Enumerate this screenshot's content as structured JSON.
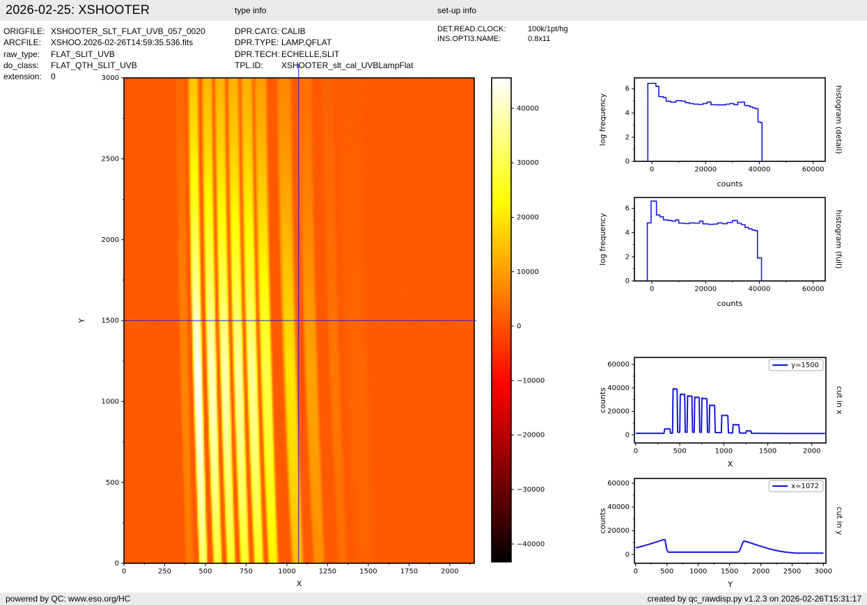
{
  "header": {
    "title": "2026-02-25: XSHOOTER",
    "type_info_label": "type info",
    "setup_info_label": "set-up info"
  },
  "metadata": {
    "file_info": [
      {
        "label": "ORIGFILE:",
        "value": "XSHOOTER_SLT_FLAT_UVB_057_0020"
      },
      {
        "label": "ARCFILE:",
        "value": "XSHOO.2026-02-26T14:59:35.536.fits"
      },
      {
        "label": "raw_type:",
        "value": "FLAT_SLIT_UVB"
      },
      {
        "label": "do_class:",
        "value": "FLAT_QTH_SLIT_UVB"
      },
      {
        "label": "extension:",
        "value": "0"
      }
    ],
    "type_info": [
      {
        "label": "DPR.CATG:",
        "value": "CALIB"
      },
      {
        "label": "DPR.TYPE:",
        "value": "LAMP,QFLAT"
      },
      {
        "label": "DPR.TECH:",
        "value": "ECHELLE,SLIT"
      },
      {
        "label": "TPL.ID:",
        "value": "XSHOOTER_slt_cal_UVBLampFlat"
      }
    ],
    "setup_info": [
      {
        "label": "DET.READ.CLOCK:",
        "value": "100k/1pt/hg"
      },
      {
        "label": "INS.OPTI3.NAME:",
        "value": "0.8x11"
      }
    ]
  },
  "footer": {
    "left": "powered by QC: www.eso.org/HC",
    "right": "created by qc_rawdisp.py v1.2.3 on 2026-02-26T15:31:17"
  },
  "colors": {
    "header_bg": "#ebebeb",
    "footer_bg": "#ebebeb",
    "plot_line": "#1616dd",
    "crosshair": "#2222e8",
    "frame": "#000000",
    "image_background_orange": "#ff5a00",
    "text": "#000000"
  },
  "chart_data": [
    {
      "id": "main-image",
      "type": "heatmap",
      "xlabel": "X",
      "ylabel": "Y",
      "xlim": [
        0,
        2150
      ],
      "ylim": [
        0,
        3000
      ],
      "xticks": [
        0,
        250,
        500,
        750,
        1000,
        1250,
        1500,
        1750,
        2000
      ],
      "yticks": [
        0,
        500,
        1000,
        1500,
        2000,
        2500,
        3000
      ],
      "xminor": [
        125,
        375,
        625,
        875,
        1125,
        1375,
        1625,
        1875,
        2125
      ],
      "yminor": [
        250,
        750,
        1250,
        1750,
        2250,
        2750
      ],
      "crosshair": {
        "x": 1072,
        "y": 1500
      },
      "background_counts": 1100,
      "colormap": {
        "name": "hot",
        "vmin": -43300,
        "vmax": 45600
      },
      "orders": [
        {
          "center": 365,
          "width": 46,
          "amp": 5000
        },
        {
          "center": 446,
          "width": 50,
          "amp": 39000
        },
        {
          "center": 532,
          "width": 52,
          "amp": 34500
        },
        {
          "center": 613,
          "width": 52,
          "amp": 33000
        },
        {
          "center": 695,
          "width": 54,
          "amp": 32000
        },
        {
          "center": 779,
          "width": 57,
          "amp": 31000
        },
        {
          "center": 865,
          "width": 60,
          "amp": 25200
        },
        {
          "center": 1011,
          "width": 70,
          "amp": 16600
        },
        {
          "center": 1140,
          "width": 70,
          "amp": 8600
        },
        {
          "center": 1283,
          "width": 56,
          "amp": 3400
        },
        {
          "center": 1420,
          "width": 120,
          "amp": 1400
        }
      ],
      "envelope": [
        [
          0,
          0.8
        ],
        [
          400,
          0.96
        ],
        [
          800,
          1.08
        ],
        [
          1200,
          1.14
        ],
        [
          1500,
          1.0
        ],
        [
          1800,
          0.85
        ],
        [
          2200,
          0.65
        ],
        [
          2600,
          0.48
        ],
        [
          3000,
          0.36
        ]
      ]
    },
    {
      "id": "colorbar",
      "type": "colorbar",
      "vmin": -43300,
      "vmax": 45600,
      "ticks": [
        40000,
        30000,
        20000,
        10000,
        0,
        -10000,
        -20000,
        -30000,
        -40000
      ]
    },
    {
      "id": "histogram-detail",
      "type": "histogram",
      "xlabel": "counts",
      "ylabel": "log frequency",
      "right_label": "histogram (detail)",
      "xlim": [
        -6500,
        64500
      ],
      "ylim": [
        0,
        6.9
      ],
      "xticks": [
        0,
        20000,
        40000,
        60000
      ],
      "yticks": [
        0,
        2,
        4,
        6
      ],
      "xminor": [
        10000,
        30000,
        50000
      ],
      "yminor": [
        1,
        3,
        5
      ],
      "steps": [
        [
          -1500,
          6.45
        ],
        [
          1500,
          6.2
        ],
        [
          2600,
          5.35
        ],
        [
          4200,
          5.28
        ],
        [
          5300,
          4.97
        ],
        [
          7000,
          4.9
        ],
        [
          9000,
          5.02
        ],
        [
          11000,
          4.98
        ],
        [
          12500,
          4.85
        ],
        [
          14000,
          4.78
        ],
        [
          15500,
          4.73
        ],
        [
          17500,
          4.7
        ],
        [
          19000,
          4.78
        ],
        [
          20500,
          4.9
        ],
        [
          22000,
          4.68
        ],
        [
          24000,
          4.67
        ],
        [
          26000,
          4.67
        ],
        [
          27500,
          4.73
        ],
        [
          29000,
          4.78
        ],
        [
          30500,
          4.68
        ],
        [
          32000,
          4.88
        ],
        [
          33500,
          4.9
        ],
        [
          34500,
          4.62
        ],
        [
          35500,
          4.6
        ],
        [
          36500,
          4.5
        ],
        [
          37500,
          4.42
        ],
        [
          38500,
          4.35
        ],
        [
          39500,
          3.25
        ],
        [
          40500,
          3.2
        ],
        [
          41000,
          0
        ]
      ]
    },
    {
      "id": "histogram-full",
      "type": "histogram",
      "xlabel": "counts",
      "ylabel": "log frequency",
      "right_label": "histogram (full)",
      "xlim": [
        -6500,
        64500
      ],
      "ylim": [
        0,
        6.9
      ],
      "xticks": [
        0,
        20000,
        40000,
        60000
      ],
      "yticks": [
        0,
        2,
        4,
        6
      ],
      "xminor": [
        10000,
        30000,
        50000
      ],
      "yminor": [
        1,
        3,
        5
      ],
      "steps": [
        [
          -1700,
          4.8
        ],
        [
          -300,
          6.6
        ],
        [
          1700,
          5.45
        ],
        [
          3000,
          5.3
        ],
        [
          4300,
          5.05
        ],
        [
          6000,
          5.0
        ],
        [
          7500,
          4.95
        ],
        [
          8800,
          5.05
        ],
        [
          10000,
          4.78
        ],
        [
          12000,
          4.75
        ],
        [
          14000,
          4.8
        ],
        [
          16000,
          4.78
        ],
        [
          17800,
          4.95
        ],
        [
          19000,
          4.72
        ],
        [
          21000,
          4.68
        ],
        [
          23000,
          4.7
        ],
        [
          24500,
          4.8
        ],
        [
          26300,
          4.73
        ],
        [
          28000,
          4.83
        ],
        [
          30000,
          5.0
        ],
        [
          31800,
          4.78
        ],
        [
          33300,
          4.65
        ],
        [
          34700,
          4.42
        ],
        [
          36000,
          4.3
        ],
        [
          37300,
          4.2
        ],
        [
          38500,
          4.15
        ],
        [
          39300,
          1.9
        ],
        [
          40800,
          0
        ]
      ]
    },
    {
      "id": "cut-in-x",
      "type": "line",
      "xlabel": "X",
      "ylabel": "counts",
      "right_label": "cut in x",
      "legend": "y=1500",
      "xlim": [
        -15,
        2160
      ],
      "ylim": [
        -7000,
        66000
      ],
      "xticks": [
        0,
        500,
        1000,
        1500,
        2000
      ],
      "yticks": [
        0,
        20000,
        40000,
        60000
      ],
      "xminor": [
        250,
        750,
        1250,
        1750
      ],
      "yminor": [
        10000,
        30000,
        50000
      ],
      "points": [
        [
          0,
          1200
        ],
        [
          320,
          1200
        ],
        [
          330,
          5000
        ],
        [
          388,
          5000
        ],
        [
          395,
          1300
        ],
        [
          418,
          1400
        ],
        [
          424,
          38500
        ],
        [
          430,
          39500
        ],
        [
          445,
          38800
        ],
        [
          460,
          39300
        ],
        [
          470,
          38700
        ],
        [
          476,
          2200
        ],
        [
          500,
          2100
        ],
        [
          506,
          34300
        ],
        [
          520,
          34800
        ],
        [
          540,
          34200
        ],
        [
          556,
          34600
        ],
        [
          562,
          2200
        ],
        [
          583,
          2100
        ],
        [
          589,
          33300
        ],
        [
          605,
          32800
        ],
        [
          625,
          33200
        ],
        [
          638,
          32900
        ],
        [
          645,
          2200
        ],
        [
          664,
          2100
        ],
        [
          670,
          32200
        ],
        [
          690,
          31800
        ],
        [
          710,
          32100
        ],
        [
          720,
          31800
        ],
        [
          727,
          2200
        ],
        [
          746,
          2100
        ],
        [
          752,
          31300
        ],
        [
          775,
          30800
        ],
        [
          800,
          31000
        ],
        [
          808,
          30700
        ],
        [
          815,
          2200
        ],
        [
          834,
          2000
        ],
        [
          840,
          25400
        ],
        [
          860,
          25000
        ],
        [
          885,
          25200
        ],
        [
          896,
          24900
        ],
        [
          903,
          1900
        ],
        [
          972,
          1800
        ],
        [
          978,
          16700
        ],
        [
          1000,
          16400
        ],
        [
          1030,
          16600
        ],
        [
          1046,
          16300
        ],
        [
          1053,
          1700
        ],
        [
          1100,
          1600
        ],
        [
          1106,
          8700
        ],
        [
          1140,
          8500
        ],
        [
          1172,
          8600
        ],
        [
          1179,
          1500
        ],
        [
          1252,
          1400
        ],
        [
          1258,
          3400
        ],
        [
          1285,
          3300
        ],
        [
          1308,
          3400
        ],
        [
          1315,
          1300
        ],
        [
          1400,
          1200
        ],
        [
          1700,
          1100
        ],
        [
          2150,
          1100
        ]
      ]
    },
    {
      "id": "cut-in-y",
      "type": "line",
      "xlabel": "Y",
      "ylabel": "counts",
      "right_label": "cut in y",
      "legend": "x=1072",
      "xlim": [
        -20,
        3040
      ],
      "ylim": [
        -7500,
        64000
      ],
      "xticks": [
        0,
        500,
        1000,
        1500,
        2000,
        2500,
        3000
      ],
      "yticks": [
        0,
        20000,
        40000,
        60000
      ],
      "xminor": [
        250,
        750,
        1250,
        1750,
        2250,
        2750
      ],
      "yminor": [
        10000,
        30000,
        50000
      ],
      "points": [
        [
          0,
          5500
        ],
        [
          100,
          6800
        ],
        [
          200,
          8300
        ],
        [
          300,
          9900
        ],
        [
          400,
          11600
        ],
        [
          450,
          12500
        ],
        [
          470,
          12300
        ],
        [
          480,
          9000
        ],
        [
          500,
          3500
        ],
        [
          520,
          1900
        ],
        [
          700,
          1850
        ],
        [
          1000,
          1850
        ],
        [
          1300,
          1850
        ],
        [
          1600,
          1850
        ],
        [
          1650,
          2200
        ],
        [
          1680,
          5500
        ],
        [
          1710,
          9800
        ],
        [
          1730,
          11200
        ],
        [
          1760,
          10900
        ],
        [
          1800,
          10300
        ],
        [
          1900,
          8500
        ],
        [
          2000,
          6800
        ],
        [
          2100,
          5200
        ],
        [
          2200,
          3800
        ],
        [
          2300,
          2700
        ],
        [
          2400,
          1900
        ],
        [
          2500,
          1350
        ],
        [
          2560,
          1100
        ],
        [
          2700,
          1050
        ],
        [
          3000,
          1050
        ]
      ]
    }
  ]
}
